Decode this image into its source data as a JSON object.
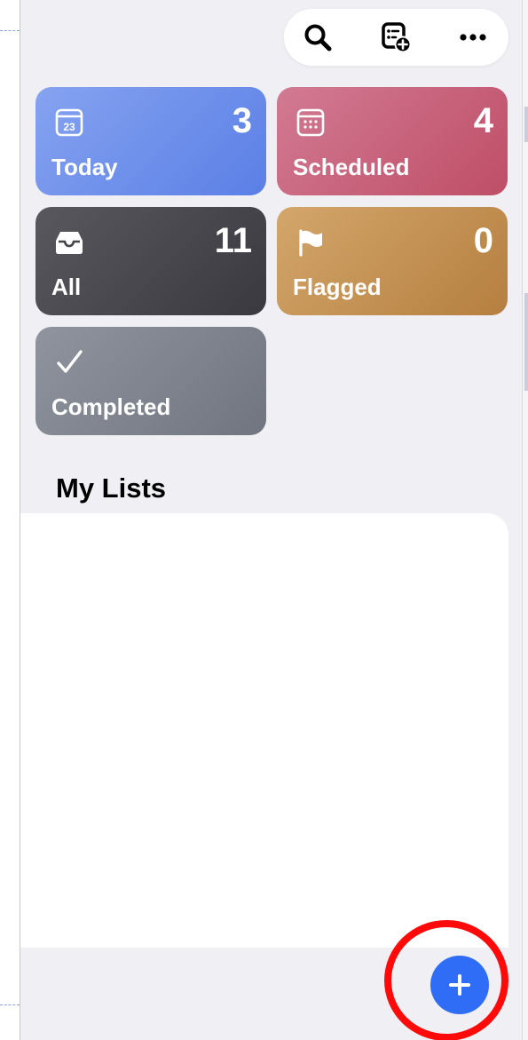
{
  "toolbar": {
    "search_icon": "search-icon",
    "new_list_icon": "list-add-icon",
    "more_icon": "ellipsis-icon"
  },
  "smart_lists": [
    {
      "label": "Today",
      "count": "3",
      "icon": "calendar-day-icon",
      "icon_text": "23",
      "color": "#6c8ded"
    },
    {
      "label": "Scheduled",
      "count": "4",
      "icon": "calendar-grid-icon",
      "color": "#c9607a"
    },
    {
      "label": "All",
      "count": "11",
      "icon": "tray-icon",
      "color": "#444349"
    },
    {
      "label": "Flagged",
      "count": "0",
      "icon": "flag-icon",
      "color": "#c5914f"
    },
    {
      "label": "Completed",
      "icon": "checkmark-icon",
      "color": "#7f848e"
    }
  ],
  "my_lists": {
    "title": "My Lists",
    "items": []
  },
  "fab": {
    "icon": "plus-icon",
    "color": "#2f6df6"
  },
  "annotation": {
    "color": "#ff0a0a"
  }
}
